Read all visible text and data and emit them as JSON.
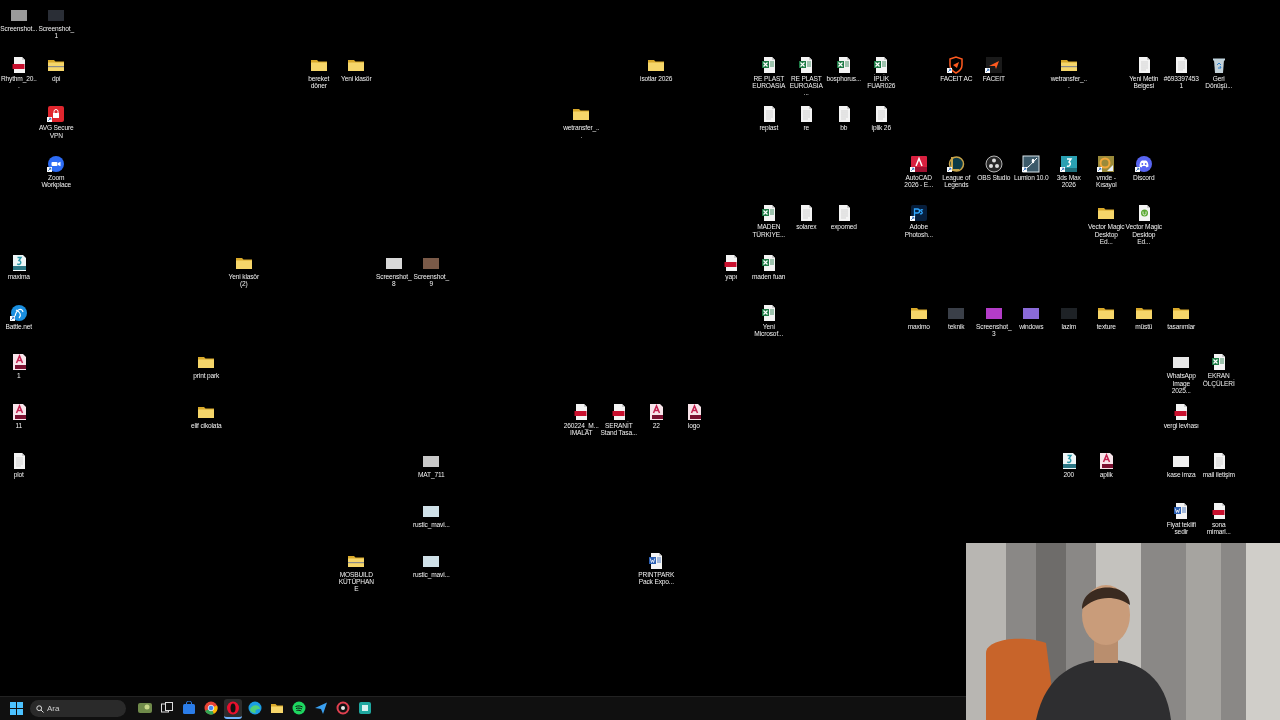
{
  "desktop": {
    "icons": [
      {
        "label": "Screenshot...",
        "color": "#9a9a9a",
        "shortcut": false
      },
      {
        "label": "Screenshot_1",
        "color": "#2a2e36",
        "shortcut": false
      },
      {
        "label": "Rhythm_20...",
        "kind": "pdf",
        "shortcut": false
      },
      {
        "label": "dpi",
        "kind": "zip",
        "shortcut": false
      },
      {
        "label": "bereket döner",
        "kind": "folder",
        "shortcut": false
      },
      {
        "label": "Yeni klasör",
        "kind": "folder",
        "shortcut": false
      },
      {
        "label": "isotlar 2026",
        "kind": "folder",
        "shortcut": false
      },
      {
        "label": "RE PLAST EUROASİA",
        "kind": "excel",
        "shortcut": false
      },
      {
        "label": "RE PLAST EUROASİA ...",
        "kind": "excel",
        "shortcut": false
      },
      {
        "label": "bosphorus...",
        "kind": "excel",
        "shortcut": false
      },
      {
        "label": "İPLİK FUAR026",
        "kind": "excel",
        "shortcut": false
      },
      {
        "label": "FACEIT AC",
        "kind": "faceitac",
        "shortcut": true
      },
      {
        "label": "FACEIT",
        "kind": "faceit",
        "shortcut": true
      },
      {
        "label": "wetransfer_...",
        "kind": "zip",
        "shortcut": false
      },
      {
        "label": "Yeni Metin Belgesi",
        "kind": "txt",
        "shortcut": false
      },
      {
        "label": "#6933974531",
        "kind": "txt",
        "shortcut": false
      },
      {
        "label": "Geri Dönüşü...",
        "kind": "recycle",
        "shortcut": false
      },
      {
        "label": "AVG Secure VPN",
        "kind": "avg",
        "shortcut": true
      },
      {
        "label": "wetransfer_...",
        "kind": "folder",
        "shortcut": false
      },
      {
        "label": "replast",
        "kind": "txt",
        "shortcut": false
      },
      {
        "label": "re",
        "kind": "txt",
        "shortcut": false
      },
      {
        "label": "bb",
        "kind": "txt",
        "shortcut": false
      },
      {
        "label": "iplik 26",
        "kind": "txt",
        "shortcut": false
      },
      {
        "label": "Zoom Workplace",
        "kind": "zoom",
        "shortcut": true
      },
      {
        "label": "AutoCAD 2026 - E...",
        "kind": "autocad",
        "shortcut": true
      },
      {
        "label": "League of Legends",
        "kind": "lol",
        "shortcut": true
      },
      {
        "label": "OBS Studio",
        "kind": "obs",
        "shortcut": false
      },
      {
        "label": "Lumion 10.0",
        "kind": "lumion",
        "shortcut": true
      },
      {
        "label": "3ds Max 2026",
        "kind": "maxapp",
        "shortcut": true
      },
      {
        "label": "vmde - Kısayol",
        "kind": "vmde",
        "shortcut": true
      },
      {
        "label": "Discord",
        "kind": "discord",
        "shortcut": true
      },
      {
        "label": "MADEN TÜRKİYE...",
        "kind": "excel",
        "shortcut": false
      },
      {
        "label": "solarex",
        "kind": "txt",
        "shortcut": false
      },
      {
        "label": "expomed",
        "kind": "txt",
        "shortcut": false
      },
      {
        "label": "Adobe Photosh...",
        "kind": "photoshop",
        "shortcut": true
      },
      {
        "label": "Vector Magic Desktop Ed...",
        "kind": "folder",
        "shortcut": false
      },
      {
        "label": "Vector Magic Desktop Ed...",
        "kind": "torrent",
        "shortcut": false
      },
      {
        "label": "maxima",
        "kind": "max",
        "shortcut": false
      },
      {
        "label": "Yeni klasör (2)",
        "kind": "folder",
        "shortcut": false
      },
      {
        "label": "Screenshot_8",
        "color": "#d8d8d8",
        "shortcut": false
      },
      {
        "label": "Screenshot_9",
        "color": "#7a5a48",
        "shortcut": false
      },
      {
        "label": "yapı",
        "kind": "pdf",
        "shortcut": false
      },
      {
        "label": "maden fuarı",
        "kind": "excel",
        "shortcut": false
      },
      {
        "label": "Battle.net",
        "kind": "battlenet",
        "shortcut": true
      },
      {
        "label": "Yeni Microsof...",
        "kind": "excel",
        "shortcut": false
      },
      {
        "label": "maximo",
        "kind": "folder",
        "shortcut": false
      },
      {
        "label": "teknik",
        "color": "#3a3f48",
        "shortcut": false
      },
      {
        "label": "Screenshot_3",
        "color": "#b43cc8",
        "shortcut": false
      },
      {
        "label": "windows",
        "color": "#8a6ad8",
        "shortcut": false
      },
      {
        "label": "lazim",
        "color": "#1e2226",
        "shortcut": false
      },
      {
        "label": "texture",
        "kind": "folder",
        "shortcut": false
      },
      {
        "label": "müstü",
        "kind": "folder",
        "shortcut": false
      },
      {
        "label": "tasarımlar",
        "kind": "folder",
        "shortcut": false
      },
      {
        "label": "1",
        "kind": "fbx",
        "shortcut": false
      },
      {
        "label": "print park",
        "kind": "folder",
        "shortcut": false
      },
      {
        "label": "WhatsApp Image 2025...",
        "color": "#e8e8e8",
        "shortcut": false
      },
      {
        "label": "EKRAN ÖLÇÜLERİ",
        "kind": "excel",
        "shortcut": false
      },
      {
        "label": "11",
        "kind": "fbx",
        "shortcut": false
      },
      {
        "label": "elif cikolata",
        "kind": "folder",
        "shortcut": false
      },
      {
        "label": "260224_M... IMALAT",
        "kind": "pdf",
        "shortcut": false
      },
      {
        "label": "SERANİT Stand Tasa...",
        "kind": "pdf",
        "shortcut": false
      },
      {
        "label": "22",
        "kind": "fbx",
        "shortcut": false
      },
      {
        "label": "logo",
        "kind": "fbx",
        "shortcut": false
      },
      {
        "label": "vergi levhası",
        "kind": "pdf",
        "shortcut": false
      },
      {
        "label": "plot",
        "kind": "txt",
        "shortcut": false
      },
      {
        "label": "MAT_711",
        "color": "#c8c8c8",
        "shortcut": false
      },
      {
        "label": "200",
        "kind": "max",
        "shortcut": false
      },
      {
        "label": "aplik",
        "kind": "fbx",
        "shortcut": false
      },
      {
        "label": "kase imza",
        "color": "#f0f0f0",
        "shortcut": false
      },
      {
        "label": "mail iletişim",
        "kind": "txt",
        "shortcut": false
      },
      {
        "label": "rustic_mavi...",
        "color": "#cfe0e8",
        "shortcut": false
      },
      {
        "label": "Fiyat teklifi sedir",
        "kind": "word",
        "shortcut": false
      },
      {
        "label": "sona mimarl...",
        "kind": "pdf",
        "shortcut": false
      },
      {
        "label": "MOSBUILD KÜTÜPHANE",
        "kind": "zip",
        "shortcut": false
      },
      {
        "label": "rustic_mavi...",
        "color": "#cfe0e8",
        "shortcut": false
      },
      {
        "label": "PRINTPARK Pack Expo...",
        "kind": "word",
        "shortcut": false
      }
    ]
  },
  "taskbar": {
    "search": {
      "placeholder": "Ara"
    },
    "apps": [
      {
        "kind": "widget",
        "active": false
      },
      {
        "kind": "taskview",
        "active": false
      },
      {
        "kind": "store",
        "active": false
      },
      {
        "kind": "chrome",
        "active": false
      },
      {
        "kind": "opera",
        "active": true
      },
      {
        "kind": "edge",
        "active": false
      },
      {
        "kind": "explorer",
        "active": false
      },
      {
        "kind": "spotify",
        "active": false
      },
      {
        "kind": "send",
        "active": false
      },
      {
        "kind": "redring",
        "active": false
      },
      {
        "kind": "teal",
        "active": false
      }
    ]
  }
}
